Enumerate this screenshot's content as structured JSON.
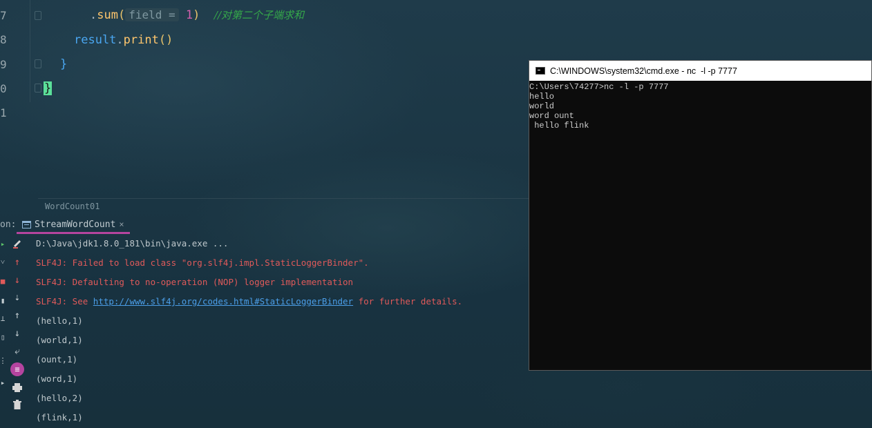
{
  "editor": {
    "line_numbers": [
      "7",
      "8",
      "9",
      "0",
      "1"
    ],
    "line7": {
      "dot": ".",
      "method": "sum",
      "open": "(",
      "hint": "field =",
      "arg": "1",
      "close": ")",
      "comment": "//对第二个子端求和"
    },
    "line8": {
      "var": "result",
      "dot": ".",
      "method": "print",
      "parens": "()"
    },
    "line9": {
      "brace": "}"
    },
    "line10": {
      "brace": "}"
    },
    "breadcrumb": "WordCount01"
  },
  "run_panel": {
    "label": "on:",
    "tab_label": "StreamWordCount",
    "tab_close": "×",
    "output": [
      {
        "text": "D:\\Java\\jdk1.8.0_181\\bin\\java.exe ...",
        "kind": "plain"
      },
      {
        "text": "SLF4J: Failed to load class \"org.slf4j.impl.StaticLoggerBinder\".",
        "kind": "red"
      },
      {
        "text": "SLF4J: Defaulting to no-operation (NOP) logger implementation",
        "kind": "red"
      },
      {
        "text_before": "SLF4J: See ",
        "link": "http://www.slf4j.org/codes.html#StaticLoggerBinder",
        "text_after": " for further details.",
        "kind": "red-link"
      },
      {
        "text": "(hello,1)",
        "kind": "plain"
      },
      {
        "text": "(world,1)",
        "kind": "plain"
      },
      {
        "text": "(ount,1)",
        "kind": "plain"
      },
      {
        "text": "(word,1)",
        "kind": "plain"
      },
      {
        "text": "(hello,2)",
        "kind": "plain"
      },
      {
        "text": "(flink,1)",
        "kind": "plain"
      }
    ]
  },
  "cmd_window": {
    "title": "C:\\WINDOWS\\system32\\cmd.exe - nc  -l -p 7777",
    "lines": [
      "C:\\Users\\74277>nc -l -p 7777",
      "hello",
      "world",
      "word ount",
      " hello flink"
    ]
  }
}
